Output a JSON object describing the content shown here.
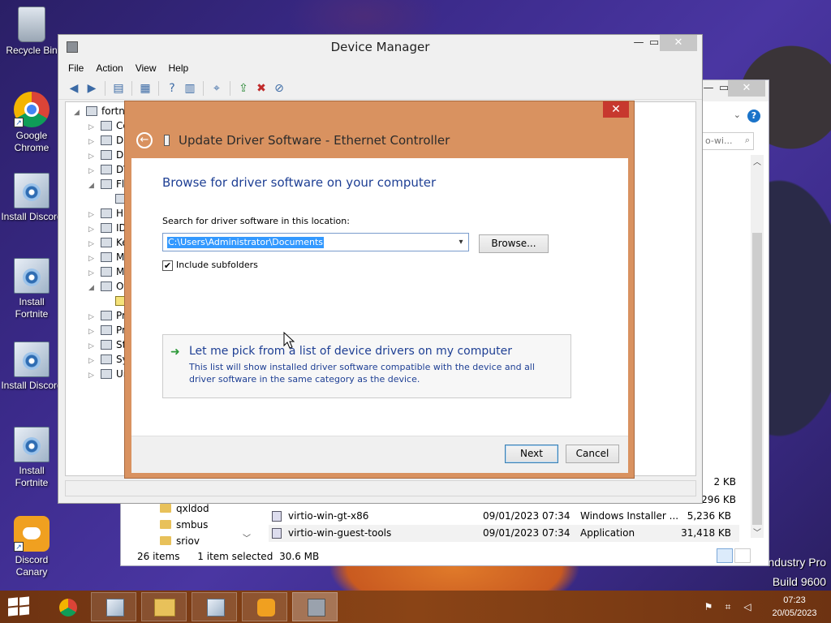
{
  "desktop": {
    "icons": [
      {
        "label": "Recycle Bin"
      },
      {
        "label": "Google Chrome"
      },
      {
        "label": "Install Discord"
      },
      {
        "label": "Install Fortnite"
      },
      {
        "label": "Install Discord"
      },
      {
        "label": "Install Fortnite"
      },
      {
        "label": "Discord Canary"
      }
    ],
    "watermark_line1": "ndustry Pro",
    "watermark_line2": "Build 9600"
  },
  "explorer": {
    "search_placeholder": "o-wi...",
    "nav_items": [
      "qxldod",
      "smbus",
      "sriov"
    ],
    "side_sizes": [
      "2 KB",
      "296 KB"
    ],
    "files": [
      {
        "name": "virtio-win-gt-x86",
        "date": "09/01/2023 07:34",
        "type": "Windows Installer ...",
        "size": "5,236 KB"
      },
      {
        "name": "virtio-win-guest-tools",
        "date": "09/01/2023 07:34",
        "type": "Application",
        "size": "31,418 KB"
      }
    ],
    "status": {
      "items": "26 items",
      "selected": "1 item selected",
      "size": "30.6 MB"
    }
  },
  "devmgr": {
    "title": "Device Manager",
    "menu": [
      "File",
      "Action",
      "View",
      "Help"
    ],
    "tree": [
      {
        "label": "fortni",
        "exp": "◢"
      },
      {
        "label": "Co",
        "exp": "▷"
      },
      {
        "label": "Di",
        "exp": "▷"
      },
      {
        "label": "Di",
        "exp": "▷"
      },
      {
        "label": "DV",
        "exp": "▷"
      },
      {
        "label": "Fl",
        "exp": "◢"
      },
      {
        "label": "",
        "exp": ""
      },
      {
        "label": "Hu",
        "exp": "▷"
      },
      {
        "label": "ID",
        "exp": "▷"
      },
      {
        "label": "Ke",
        "exp": "▷"
      },
      {
        "label": "M",
        "exp": "▷"
      },
      {
        "label": "M",
        "exp": "▷"
      },
      {
        "label": "Ot",
        "exp": "◢"
      },
      {
        "label": "",
        "exp": ""
      },
      {
        "label": "Pr",
        "exp": "▷"
      },
      {
        "label": "Pr",
        "exp": "▷"
      },
      {
        "label": "St",
        "exp": "▷"
      },
      {
        "label": "Sy",
        "exp": "▷"
      },
      {
        "label": "Ur",
        "exp": "▷"
      }
    ]
  },
  "dialog": {
    "title": "Update Driver Software - Ethernet Controller",
    "heading": "Browse for driver software on your computer",
    "search_label": "Search for driver software in this location:",
    "path_value": "C:\\Users\\Administrator\\Documents",
    "browse_label": "Browse...",
    "include_subfolders_label": "Include subfolders",
    "include_subfolders_checked": true,
    "pick_title": "Let me pick from a list of device drivers on my computer",
    "pick_desc": "This list will show installed driver software compatible with the device and all driver software in the same category as the device.",
    "next_label": "Next",
    "cancel_label": "Cancel"
  },
  "taskbar": {
    "time": "07:23",
    "date": "20/05/2023"
  },
  "colors": {
    "accent_dialog": "#d99260",
    "link_blue": "#1e3f94",
    "taskbar": "#7f3b12"
  }
}
